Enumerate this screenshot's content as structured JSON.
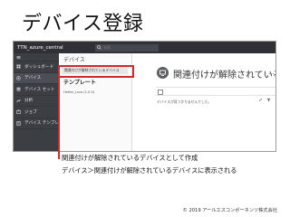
{
  "slide": {
    "title": "デバイス登録",
    "callout_line1": "関連付けが解除されているデバイスとして作成",
    "callout_line2": "デバイス＞関連付けが解除されているデバイスに表示される",
    "footer": "© 2019 アールエスコンポーネンツ株式会社"
  },
  "app": {
    "name": "TTN_azure_central",
    "search_placeholder": "検索",
    "sidebar": [
      {
        "label": "",
        "icon": "menu-icon"
      },
      {
        "label": "ダッシュボード",
        "icon": "dashboard-icon"
      },
      {
        "label": "デバイス",
        "icon": "device-icon",
        "active": true
      },
      {
        "label": "デバイス セット",
        "icon": "device-set-icon"
      },
      {
        "label": "分析",
        "icon": "analytics-icon"
      },
      {
        "label": "ジョブ",
        "icon": "jobs-icon"
      },
      {
        "label": "デバイス テンプレート",
        "icon": "template-icon"
      }
    ],
    "left_panel": {
      "heading": "デバイス",
      "selected_item": "関連付けが解除されているデバイス",
      "templates_heading": "テンプレート",
      "template_item": "Heltec_Lora (1.0.0)"
    },
    "right_panel": {
      "title": "関連付けが解除されている...",
      "more": "...",
      "empty_message": "デバイスが見つかりませんでした。"
    }
  }
}
